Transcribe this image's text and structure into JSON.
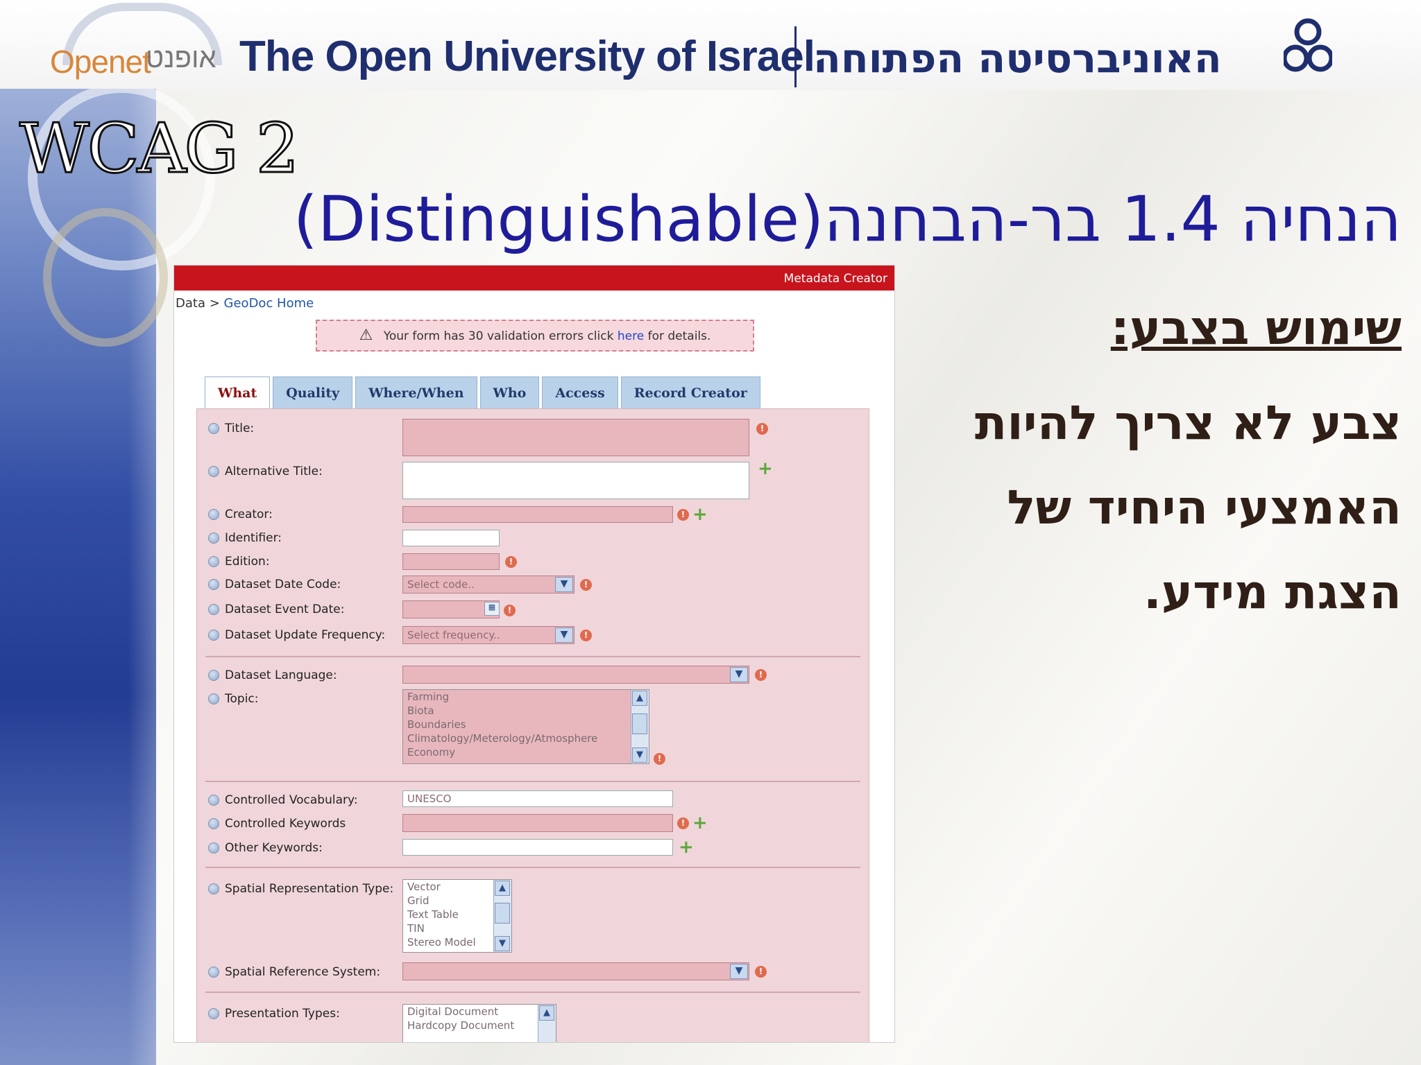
{
  "header": {
    "openet_en": "Openet",
    "openet_he": "אופנט",
    "university_en": "The Open University of Israel",
    "university_he": "האוניברסיטה הפתוחה"
  },
  "slide": {
    "title": "WCAG 2",
    "subtitle": "הנחיה 1.4 בר-הבחנה(Distinguishable)",
    "heading": "שימוש בצבע: ",
    "body_lines": [
      "צבע לא צריך להיות",
      "האמצעי היחיד של",
      "הצגת מידע."
    ]
  },
  "form": {
    "bar_title": "Metadata Creator",
    "breadcrumb_root": "Data >",
    "breadcrumb_link": "GeoDoc Home",
    "error": {
      "before": "Your form has 30 validation errors click",
      "link": "here",
      "after": "for details."
    },
    "tabs": [
      "What",
      "Quality",
      "Where/When",
      "Who",
      "Access",
      "Record Creator"
    ],
    "labels": {
      "title": "Title:",
      "alt_title": "Alternative Title:",
      "creator": "Creator:",
      "identifier": "Identifier:",
      "edition": "Edition:",
      "date_code": "Dataset Date Code:",
      "event_date": "Dataset Event Date:",
      "update_freq": "Dataset Update Frequency:",
      "language": "Dataset Language:",
      "topic": "Topic:",
      "controlled_vocab": "Controlled Vocabulary:",
      "controlled_keywords": "Controlled Keywords",
      "other_keywords": "Other Keywords:",
      "spatial_rep": "Spatial Representation Type:",
      "spatial_ref": "Spatial Reference System:",
      "presentation": "Presentation Types:"
    },
    "placeholders": {
      "date_code": "Select code..",
      "update_freq": "Select frequency..",
      "controlled_vocab": "UNESCO"
    },
    "topic_options": [
      "Farming",
      "Biota",
      "Boundaries",
      "Climatology/Meterology/Atmosphere",
      "Economy"
    ],
    "spatial_options": [
      "Vector",
      "Grid",
      "Text Table",
      "TIN",
      "Stereo Model"
    ],
    "presentation_options": [
      "Digital Document",
      "Hardcopy Document"
    ]
  },
  "colors": {
    "red_bar": "#c8141d",
    "error_field": "#e8b7bd",
    "title_blue": "#1f1c9a",
    "text_brown": "#2f1f16"
  }
}
